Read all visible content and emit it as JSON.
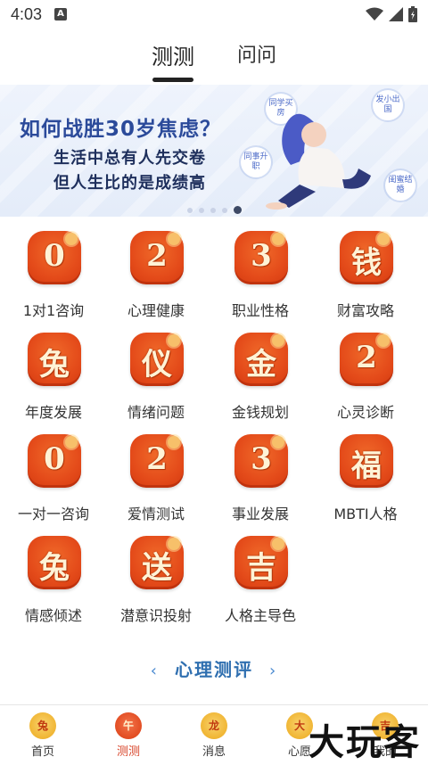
{
  "status_bar": {
    "time": "4:03",
    "notification_badge": "A"
  },
  "top_tabs": [
    {
      "label": "测测",
      "active": true
    },
    {
      "label": "问问",
      "active": false
    }
  ],
  "banner": {
    "headline": "如何战胜30岁焦虑？",
    "sub1": "生活中总有人先交卷",
    "sub2": "但人生比的是成绩高",
    "bubbles": [
      "同学买房",
      "同事升职",
      "发小出国",
      "闺蜜结婚"
    ],
    "slide_count": 5,
    "active_slide": 5
  },
  "grid": [
    {
      "glyph": "0",
      "label": "1对1咨询"
    },
    {
      "glyph": "2",
      "label": "心理健康"
    },
    {
      "glyph": "3",
      "label": "职业性格"
    },
    {
      "glyph": "钱",
      "label": "财富攻略"
    },
    {
      "glyph": "兔",
      "label": "年度发展"
    },
    {
      "glyph": "仪",
      "label": "情绪问题"
    },
    {
      "glyph": "金",
      "label": "金钱规划"
    },
    {
      "glyph": "2",
      "label": "心灵诊断"
    },
    {
      "glyph": "0",
      "label": "一对一咨询"
    },
    {
      "glyph": "2",
      "label": "爱情测试"
    },
    {
      "glyph": "3",
      "label": "事业发展"
    },
    {
      "glyph": "福",
      "label": "MBTI人格"
    },
    {
      "glyph": "兔",
      "label": "情感倾述"
    },
    {
      "glyph": "送",
      "label": "潜意识投射"
    },
    {
      "glyph": "吉",
      "label": "人格主导色"
    }
  ],
  "section_title": "心理测评",
  "bottom_nav": [
    {
      "icon": "兔",
      "label": "首页",
      "active": false
    },
    {
      "icon": "午",
      "label": "测测",
      "active": true
    },
    {
      "icon": "龙",
      "label": "消息",
      "active": false
    },
    {
      "icon": "大",
      "label": "心愿",
      "active": false
    },
    {
      "icon": "吉",
      "label": "我的",
      "active": false
    }
  ],
  "watermark": "大玩客",
  "colors": {
    "accent": "#e44b1a",
    "section_title": "#2f6fb0",
    "banner_headline": "#2b4a9a"
  }
}
